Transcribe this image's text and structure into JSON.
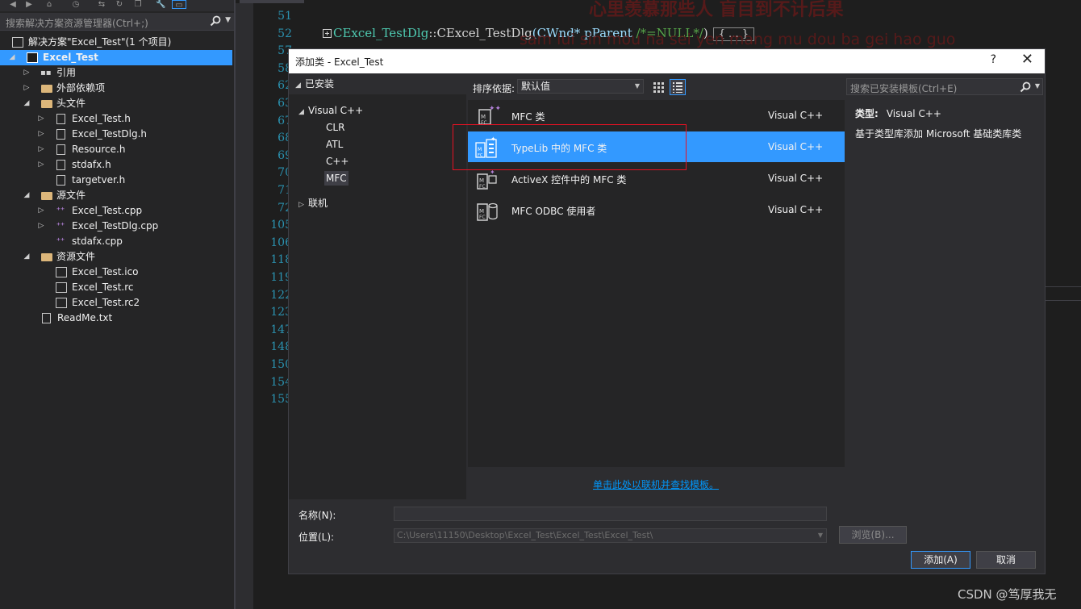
{
  "explorer": {
    "search_placeholder": "搜索解决方案资源管理器(Ctrl+;)",
    "solution_label": "解决方案\"Excel_Test\"(1 个项目)",
    "project_label": "Excel_Test",
    "items": [
      {
        "label": "引用"
      },
      {
        "label": "外部依赖项"
      },
      {
        "label": "头文件"
      },
      {
        "label": "Excel_Test.h"
      },
      {
        "label": "Excel_TestDlg.h"
      },
      {
        "label": "Resource.h"
      },
      {
        "label": "stdafx.h"
      },
      {
        "label": "targetver.h"
      },
      {
        "label": "源文件"
      },
      {
        "label": "Excel_Test.cpp"
      },
      {
        "label": "Excel_TestDlg.cpp"
      },
      {
        "label": "stdafx.cpp"
      },
      {
        "label": "资源文件"
      },
      {
        "label": "Excel_Test.ico"
      },
      {
        "label": "Excel_Test.rc"
      },
      {
        "label": "Excel_Test.rc2"
      },
      {
        "label": "ReadMe.txt"
      }
    ]
  },
  "editor": {
    "line_numbers": [
      "51",
      "52",
      "57",
      "58",
      "62",
      "63",
      "67",
      "68",
      "69",
      "70",
      "71",
      "72",
      "105",
      "106",
      "118",
      "119",
      "122",
      "123",
      "147",
      "148",
      "150",
      "154",
      "155"
    ],
    "code": {
      "class_name": "CExcel_TestDlg",
      "sep": "::",
      "ctor": "CExcel_TestDlg",
      "params": "(CWnd* pParent ",
      "comment": "/*=NULL*/",
      "close": ")",
      "brace": "{ ... }"
    },
    "overlay_lyrics": "心里羡慕那些人 盲目到不计后果",
    "overlay_pinyin": "sam lui sin mou na sei yen mang mu dou ba gei hao guo"
  },
  "dialog": {
    "title": "添加类 - Excel_Test",
    "help": "?",
    "close": "✕",
    "installed_label": "已安装",
    "categories": {
      "root": "Visual C++",
      "children": [
        "CLR",
        "ATL",
        "C++",
        "MFC"
      ],
      "online": "联机"
    },
    "sort_label": "排序依据:",
    "sort_value": "默认值",
    "templates": [
      {
        "name": "MFC 类",
        "lang": "Visual C++"
      },
      {
        "name": "TypeLib 中的 MFC 类",
        "lang": "Visual C++"
      },
      {
        "name": "ActiveX 控件中的 MFC 类",
        "lang": "Visual C++"
      },
      {
        "name": "MFC ODBC 使用者",
        "lang": "Visual C++"
      }
    ],
    "search_placeholder": "搜索已安装模板(Ctrl+E)",
    "type_key": "类型:",
    "type_value": "Visual C++",
    "description": "基于类型库添加 Microsoft 基础类库类",
    "online_link": "单击此处以联机并查找模板。",
    "name_label": "名称(N):",
    "name_value": "",
    "location_label": "位置(L):",
    "location_value": "C:\\Users\\11150\\Desktop\\Excel_Test\\Excel_Test\\Excel_Test\\",
    "browse_label": "浏览(B)...",
    "add_label": "添加(A)",
    "cancel_label": "取消"
  },
  "watermark": "CSDN @笃厚我无",
  "colors": {
    "selection": "#3399ff",
    "annotation_box": "#e81123",
    "link": "#0097fb"
  }
}
